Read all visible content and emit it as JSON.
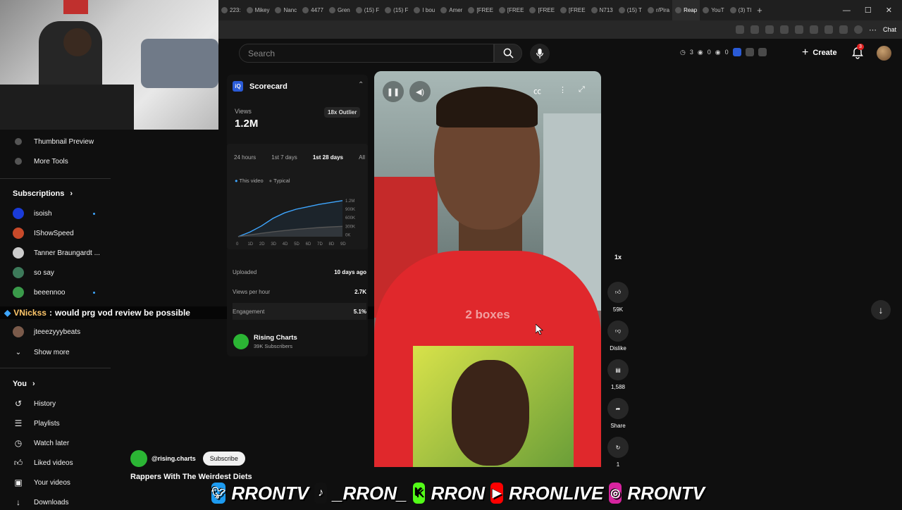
{
  "browser": {
    "tabs": [
      {
        "label": "223:"
      },
      {
        "label": "Mikey"
      },
      {
        "label": "Nanc"
      },
      {
        "label": "4477"
      },
      {
        "label": "Gren"
      },
      {
        "label": "(15) F"
      },
      {
        "label": "(15) F"
      },
      {
        "label": "I bou"
      },
      {
        "label": "Amer"
      },
      {
        "label": "[FREE"
      },
      {
        "label": "[FREE"
      },
      {
        "label": "[FREE"
      },
      {
        "label": "[FREE"
      },
      {
        "label": "N713"
      },
      {
        "label": "(15) T"
      },
      {
        "label": "r/Pira"
      },
      {
        "label": "Reap",
        "active": true
      },
      {
        "label": "YouT"
      },
      {
        "label": "(3) Tl"
      }
    ],
    "new_tab_label": "+",
    "chat_label": "Chat"
  },
  "masthead": {
    "search_placeholder": "Search",
    "ext_stats": [
      "3",
      "0",
      "0"
    ],
    "create_label": "Create",
    "notification_count": "3"
  },
  "sidebar": {
    "tools": [
      {
        "label": "Thumbnail Preview"
      },
      {
        "label": "More Tools"
      }
    ],
    "subscriptions_title": "Subscriptions",
    "subscriptions": [
      {
        "label": "isoish",
        "color": "#1a3bd8",
        "live": true
      },
      {
        "label": "IShowSpeed",
        "color": "#c84a2a",
        "live": false
      },
      {
        "label": "Tanner Braungardt ...",
        "color": "#cccccc",
        "live": false
      },
      {
        "label": "so say",
        "color": "#3d7a5a",
        "live": false
      },
      {
        "label": "beeennoo",
        "color": "#3a9a4a",
        "live": true
      },
      {
        "label": "jteeezyyybeats",
        "color": "#7a5a4a",
        "live": false
      }
    ],
    "show_more": "Show more",
    "you_title": "You",
    "you_items": [
      {
        "label": "History"
      },
      {
        "label": "Playlists"
      },
      {
        "label": "Watch later"
      },
      {
        "label": "Liked videos"
      },
      {
        "label": "Your videos"
      },
      {
        "label": "Downloads"
      }
    ]
  },
  "chat_overlay": {
    "user": "VNickss",
    "message": "would prg vod review be possible"
  },
  "scorecard": {
    "title": "Scorecard",
    "views_label": "Views",
    "views_value": "1.2M",
    "outlier_badge": "18x Outlier",
    "time_tabs": [
      "24 hours",
      "1st 7 days",
      "1st 28 days",
      "All"
    ],
    "active_tab": "1st 28 days",
    "legend": [
      "This video",
      "Typical"
    ],
    "y_ticks": [
      "1.2M",
      "900K",
      "600K",
      "300K",
      "0K"
    ],
    "x_ticks": [
      "0",
      "1D",
      "2D",
      "3D",
      "4D",
      "5D",
      "6D",
      "7D",
      "8D",
      "9D"
    ],
    "stats": [
      {
        "label": "Uploaded",
        "value": "10 days ago"
      },
      {
        "label": "Views per hour",
        "value": "2.7K"
      },
      {
        "label": "Engagement",
        "value": "5.1%"
      }
    ],
    "channel_name": "Rising Charts",
    "channel_subs": "39K Subscribers",
    "chart_data": {
      "type": "line",
      "x": [
        0,
        1,
        2,
        3,
        4,
        5,
        6,
        7,
        8,
        9
      ],
      "series": [
        {
          "name": "This video",
          "values": [
            0,
            150000,
            350000,
            600000,
            780000,
            900000,
            980000,
            1060000,
            1120000,
            1180000
          ]
        },
        {
          "name": "Typical",
          "values": [
            0,
            60000,
            110000,
            160000,
            200000,
            240000,
            270000,
            300000,
            320000,
            340000
          ]
        }
      ],
      "ylim": [
        0,
        1200000
      ],
      "color_this": "#3ea6ff",
      "color_typical": "#555555"
    }
  },
  "video": {
    "caption": "2 boxes",
    "speed": "1x",
    "channel_handle": "@rising.charts",
    "subscribe_label": "Subscribe",
    "title": "Rappers With The Weirdest Diets"
  },
  "actions": {
    "likes": "59K",
    "dislike_label": "Dislike",
    "comments": "1,588",
    "share_label": "Share",
    "remix_count": "1"
  },
  "socials": {
    "twitter": "RRONTV",
    "tiktok": "_RRON_",
    "kick": "RRON",
    "youtube": "RRONLIVE",
    "instagram": "RRONTV"
  }
}
